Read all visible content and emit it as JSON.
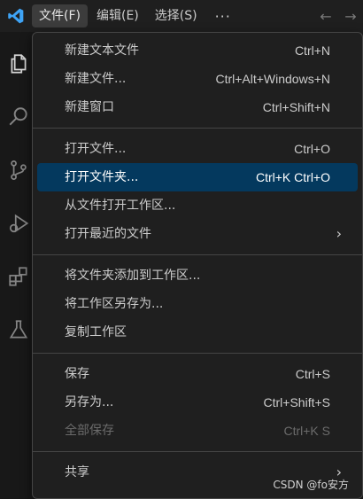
{
  "menubar": {
    "items": [
      "文件(F)",
      "编辑(E)",
      "选择(S)"
    ],
    "more": "···"
  },
  "nav": {
    "back": "←",
    "forward": "→"
  },
  "file_menu": {
    "groups": [
      [
        {
          "label": "新建文本文件",
          "shortcut": "Ctrl+N"
        },
        {
          "label": "新建文件...",
          "shortcut": "Ctrl+Alt+Windows+N"
        },
        {
          "label": "新建窗口",
          "shortcut": "Ctrl+Shift+N"
        }
      ],
      [
        {
          "label": "打开文件...",
          "shortcut": "Ctrl+O"
        },
        {
          "label": "打开文件夹...",
          "shortcut": "Ctrl+K Ctrl+O"
        },
        {
          "label": "从文件打开工作区...",
          "shortcut": ""
        },
        {
          "label": "打开最近的文件",
          "shortcut": "",
          "submenu": true
        }
      ],
      [
        {
          "label": "将文件夹添加到工作区...",
          "shortcut": ""
        },
        {
          "label": "将工作区另存为...",
          "shortcut": ""
        },
        {
          "label": "复制工作区",
          "shortcut": ""
        }
      ],
      [
        {
          "label": "保存",
          "shortcut": "Ctrl+S"
        },
        {
          "label": "另存为...",
          "shortcut": "Ctrl+Shift+S"
        },
        {
          "label": "全部保存",
          "shortcut": "Ctrl+K S",
          "disabled": true
        }
      ],
      [
        {
          "label": "共享",
          "shortcut": "",
          "submenu": true
        }
      ]
    ],
    "highlighted": "打开文件夹..."
  },
  "watermark": "CSDN @fo安方",
  "colors": {
    "accent": "#04395e",
    "logo": "#3ea3f5"
  },
  "icons": [
    "vscode-logo-icon",
    "explorer-icon",
    "search-icon",
    "source-control-icon",
    "run-debug-icon",
    "extensions-icon",
    "testing-icon"
  ]
}
